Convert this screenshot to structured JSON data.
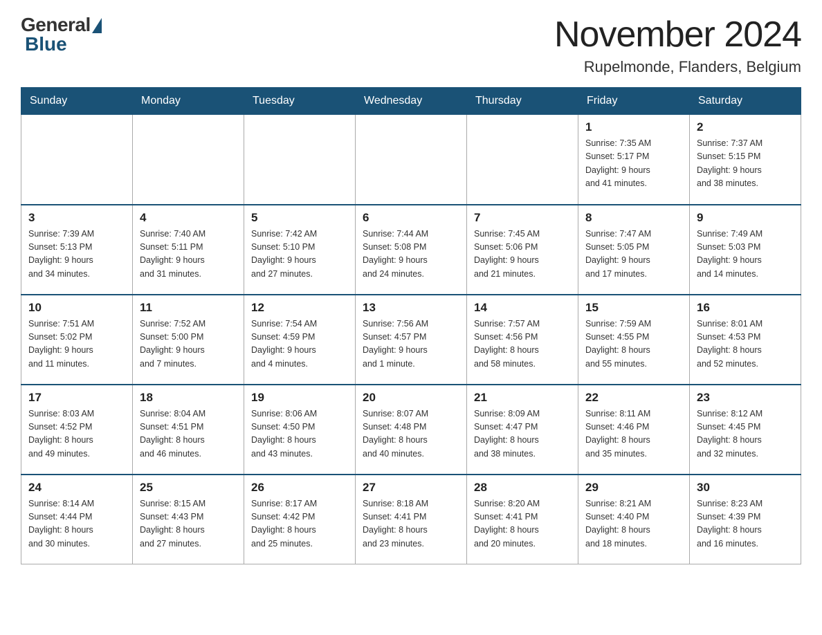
{
  "logo": {
    "general": "General",
    "blue": "Blue"
  },
  "title": "November 2024",
  "location": "Rupelmonde, Flanders, Belgium",
  "days_of_week": [
    "Sunday",
    "Monday",
    "Tuesday",
    "Wednesday",
    "Thursday",
    "Friday",
    "Saturday"
  ],
  "weeks": [
    [
      {
        "day": "",
        "info": ""
      },
      {
        "day": "",
        "info": ""
      },
      {
        "day": "",
        "info": ""
      },
      {
        "day": "",
        "info": ""
      },
      {
        "day": "",
        "info": ""
      },
      {
        "day": "1",
        "info": "Sunrise: 7:35 AM\nSunset: 5:17 PM\nDaylight: 9 hours\nand 41 minutes."
      },
      {
        "day": "2",
        "info": "Sunrise: 7:37 AM\nSunset: 5:15 PM\nDaylight: 9 hours\nand 38 minutes."
      }
    ],
    [
      {
        "day": "3",
        "info": "Sunrise: 7:39 AM\nSunset: 5:13 PM\nDaylight: 9 hours\nand 34 minutes."
      },
      {
        "day": "4",
        "info": "Sunrise: 7:40 AM\nSunset: 5:11 PM\nDaylight: 9 hours\nand 31 minutes."
      },
      {
        "day": "5",
        "info": "Sunrise: 7:42 AM\nSunset: 5:10 PM\nDaylight: 9 hours\nand 27 minutes."
      },
      {
        "day": "6",
        "info": "Sunrise: 7:44 AM\nSunset: 5:08 PM\nDaylight: 9 hours\nand 24 minutes."
      },
      {
        "day": "7",
        "info": "Sunrise: 7:45 AM\nSunset: 5:06 PM\nDaylight: 9 hours\nand 21 minutes."
      },
      {
        "day": "8",
        "info": "Sunrise: 7:47 AM\nSunset: 5:05 PM\nDaylight: 9 hours\nand 17 minutes."
      },
      {
        "day": "9",
        "info": "Sunrise: 7:49 AM\nSunset: 5:03 PM\nDaylight: 9 hours\nand 14 minutes."
      }
    ],
    [
      {
        "day": "10",
        "info": "Sunrise: 7:51 AM\nSunset: 5:02 PM\nDaylight: 9 hours\nand 11 minutes."
      },
      {
        "day": "11",
        "info": "Sunrise: 7:52 AM\nSunset: 5:00 PM\nDaylight: 9 hours\nand 7 minutes."
      },
      {
        "day": "12",
        "info": "Sunrise: 7:54 AM\nSunset: 4:59 PM\nDaylight: 9 hours\nand 4 minutes."
      },
      {
        "day": "13",
        "info": "Sunrise: 7:56 AM\nSunset: 4:57 PM\nDaylight: 9 hours\nand 1 minute."
      },
      {
        "day": "14",
        "info": "Sunrise: 7:57 AM\nSunset: 4:56 PM\nDaylight: 8 hours\nand 58 minutes."
      },
      {
        "day": "15",
        "info": "Sunrise: 7:59 AM\nSunset: 4:55 PM\nDaylight: 8 hours\nand 55 minutes."
      },
      {
        "day": "16",
        "info": "Sunrise: 8:01 AM\nSunset: 4:53 PM\nDaylight: 8 hours\nand 52 minutes."
      }
    ],
    [
      {
        "day": "17",
        "info": "Sunrise: 8:03 AM\nSunset: 4:52 PM\nDaylight: 8 hours\nand 49 minutes."
      },
      {
        "day": "18",
        "info": "Sunrise: 8:04 AM\nSunset: 4:51 PM\nDaylight: 8 hours\nand 46 minutes."
      },
      {
        "day": "19",
        "info": "Sunrise: 8:06 AM\nSunset: 4:50 PM\nDaylight: 8 hours\nand 43 minutes."
      },
      {
        "day": "20",
        "info": "Sunrise: 8:07 AM\nSunset: 4:48 PM\nDaylight: 8 hours\nand 40 minutes."
      },
      {
        "day": "21",
        "info": "Sunrise: 8:09 AM\nSunset: 4:47 PM\nDaylight: 8 hours\nand 38 minutes."
      },
      {
        "day": "22",
        "info": "Sunrise: 8:11 AM\nSunset: 4:46 PM\nDaylight: 8 hours\nand 35 minutes."
      },
      {
        "day": "23",
        "info": "Sunrise: 8:12 AM\nSunset: 4:45 PM\nDaylight: 8 hours\nand 32 minutes."
      }
    ],
    [
      {
        "day": "24",
        "info": "Sunrise: 8:14 AM\nSunset: 4:44 PM\nDaylight: 8 hours\nand 30 minutes."
      },
      {
        "day": "25",
        "info": "Sunrise: 8:15 AM\nSunset: 4:43 PM\nDaylight: 8 hours\nand 27 minutes."
      },
      {
        "day": "26",
        "info": "Sunrise: 8:17 AM\nSunset: 4:42 PM\nDaylight: 8 hours\nand 25 minutes."
      },
      {
        "day": "27",
        "info": "Sunrise: 8:18 AM\nSunset: 4:41 PM\nDaylight: 8 hours\nand 23 minutes."
      },
      {
        "day": "28",
        "info": "Sunrise: 8:20 AM\nSunset: 4:41 PM\nDaylight: 8 hours\nand 20 minutes."
      },
      {
        "day": "29",
        "info": "Sunrise: 8:21 AM\nSunset: 4:40 PM\nDaylight: 8 hours\nand 18 minutes."
      },
      {
        "day": "30",
        "info": "Sunrise: 8:23 AM\nSunset: 4:39 PM\nDaylight: 8 hours\nand 16 minutes."
      }
    ]
  ]
}
